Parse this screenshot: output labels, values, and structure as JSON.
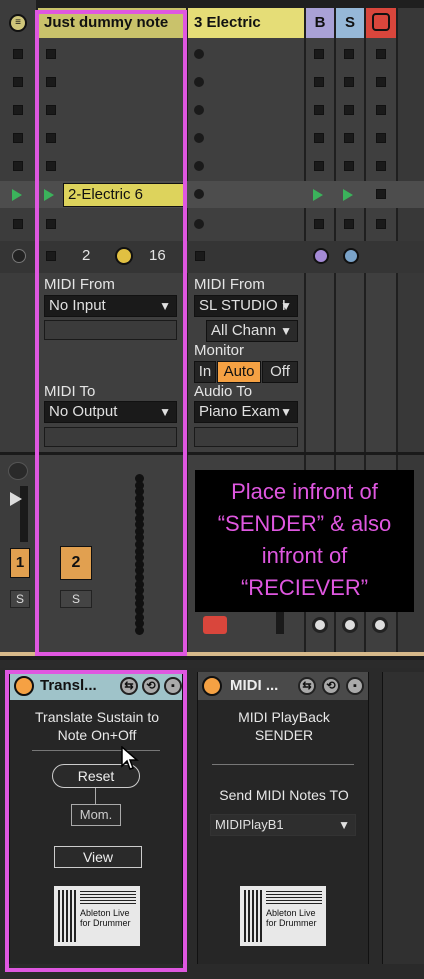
{
  "tracks": {
    "dummy": {
      "name": "Just dummy note",
      "color": "#c9c26b"
    },
    "electric": {
      "name": "3 Electric",
      "color": "#e5dd77"
    },
    "b": {
      "label": "B",
      "color": "#a9a1d6"
    },
    "s": {
      "label": "S",
      "color": "#96b8d8"
    }
  },
  "clip": {
    "name": "2-Electric 6",
    "color": "#ddd35c"
  },
  "dummy_controls": {
    "value1": "2",
    "value2": "16"
  },
  "io_dummy": {
    "midi_from_label": "MIDI From",
    "midi_from_value": "No Input",
    "midi_to_label": "MIDI To",
    "midi_to_value": "No Output"
  },
  "io_electric": {
    "midi_from_label": "MIDI From",
    "midi_from_value": "SL STUDIO I",
    "channel_value": "All Chann",
    "monitor_label": "Monitor",
    "monitor_in": "In",
    "monitor_auto": "Auto",
    "monitor_off": "Off",
    "audio_to_label": "Audio To",
    "audio_to_value": "Piano Exam"
  },
  "mixer": {
    "track1_number": "1",
    "track2_number": "2",
    "solo_label": "S"
  },
  "annotation": {
    "line1": "Place infront of",
    "line2": "“SENDER” & also",
    "line3": "infront of",
    "line4": "“RECIEVER”"
  },
  "device1": {
    "title": "Transl...",
    "desc_line1": "Translate Sustain to",
    "desc_line2": "Note On+Off",
    "reset_label": "Reset",
    "mom_label": "Mom.",
    "view_label": "View",
    "logo_line1": "Ableton Live",
    "logo_line2": "for Drummer"
  },
  "device2": {
    "title": "MIDI ...",
    "desc_line1": "MIDI PlayBack",
    "desc_line2": "SENDER",
    "send_label": "Send MIDI Notes TO",
    "send_value": "MIDIPlayB1",
    "logo_line1": "Ableton Live",
    "logo_line2": "for Drummer"
  },
  "colors": {
    "highlight": "#df57e0",
    "orange": "#f5a143",
    "play_green": "#3bb35b"
  }
}
